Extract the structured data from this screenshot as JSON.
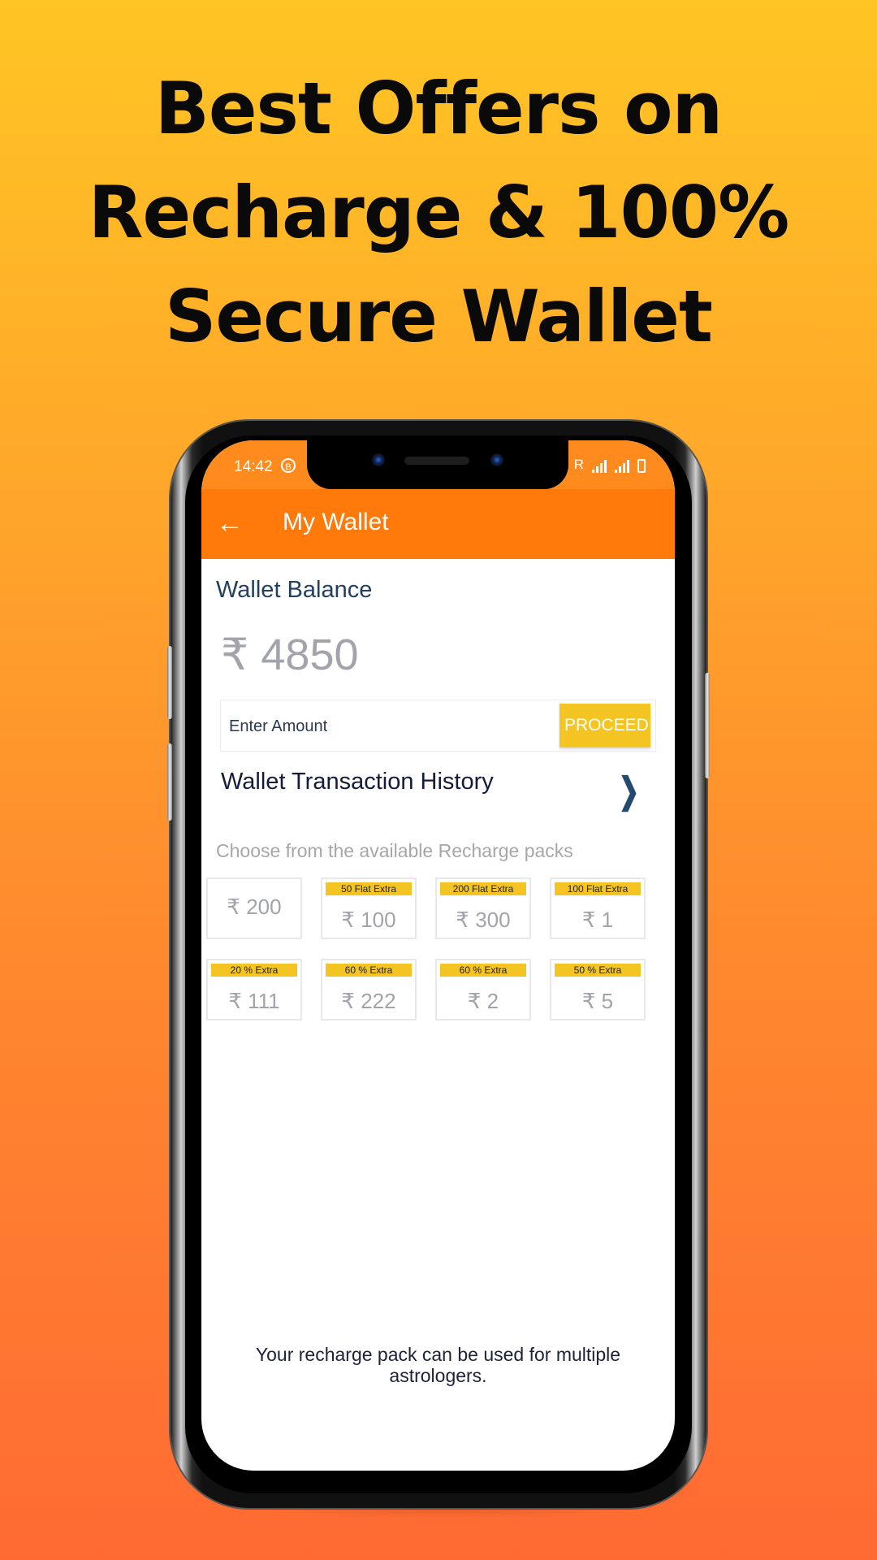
{
  "headline": {
    "lines": [
      "Best Offers on",
      "Recharge & 100%",
      "Secure Wallet"
    ]
  },
  "status_bar": {
    "time": "14:42",
    "left_icons": [
      "b-notification-icon"
    ],
    "network_label": "R",
    "right_icons": [
      "signal-icon",
      "signal-icon",
      "battery-icon"
    ]
  },
  "app_bar": {
    "back_icon": "arrow-left-icon",
    "title": "My Wallet",
    "color": "#FF7A0A"
  },
  "wallet": {
    "balance_label": "Wallet Balance",
    "currency_symbol": "₹",
    "balance_value": "4850",
    "amount_placeholder": "Enter Amount",
    "amount_value": "",
    "proceed_label": "PROCEED",
    "proceed_color": "#F3C422"
  },
  "history": {
    "label": "Wallet Transaction History",
    "chevron_icon": "chevron-right-icon"
  },
  "packs": {
    "heading": "Choose from the available Recharge packs",
    "items": [
      {
        "tag": "",
        "price": "₹ 200"
      },
      {
        "tag": "50 Flat Extra",
        "price": "₹ 100"
      },
      {
        "tag": "200 Flat Extra",
        "price": "₹ 300"
      },
      {
        "tag": "100 Flat Extra",
        "price": "₹ 1"
      },
      {
        "tag": "20 % Extra",
        "price": "₹ 111"
      },
      {
        "tag": "60 % Extra",
        "price": "₹ 222"
      },
      {
        "tag": "60 % Extra",
        "price": "₹ 2"
      },
      {
        "tag": "50 % Extra",
        "price": "₹ 5"
      }
    ],
    "tag_color": "#F3C422"
  },
  "footnote": "Your recharge pack can be used for multiple astrologers."
}
